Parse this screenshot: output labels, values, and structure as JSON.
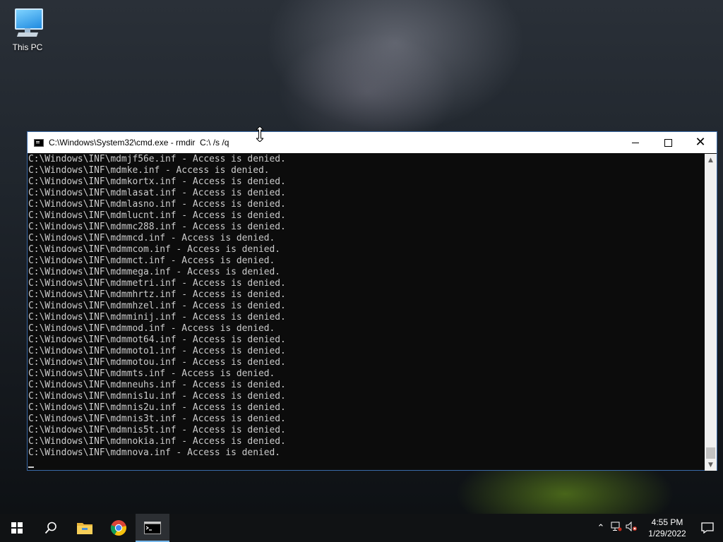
{
  "desktop": {
    "icons": [
      {
        "label": "This PC",
        "icon": "computer-icon"
      }
    ]
  },
  "cmd_window": {
    "title": "C:\\Windows\\System32\\cmd.exe - rmdir  C:\\ /s /q",
    "icon": "command-prompt-icon",
    "buttons": {
      "minimize": "minimize-icon",
      "maximize": "maximize-icon",
      "close": "close-icon"
    },
    "lines": [
      "C:\\Windows\\INF\\mdmjf56e.inf - Access is denied.",
      "C:\\Windows\\INF\\mdmke.inf - Access is denied.",
      "C:\\Windows\\INF\\mdmkortx.inf - Access is denied.",
      "C:\\Windows\\INF\\mdmlasat.inf - Access is denied.",
      "C:\\Windows\\INF\\mdmlasno.inf - Access is denied.",
      "C:\\Windows\\INF\\mdmlucnt.inf - Access is denied.",
      "C:\\Windows\\INF\\mdmmc288.inf - Access is denied.",
      "C:\\Windows\\INF\\mdmmcd.inf - Access is denied.",
      "C:\\Windows\\INF\\mdmmcom.inf - Access is denied.",
      "C:\\Windows\\INF\\mdmmct.inf - Access is denied.",
      "C:\\Windows\\INF\\mdmmega.inf - Access is denied.",
      "C:\\Windows\\INF\\mdmmetri.inf - Access is denied.",
      "C:\\Windows\\INF\\mdmmhrtz.inf - Access is denied.",
      "C:\\Windows\\INF\\mdmmhzel.inf - Access is denied.",
      "C:\\Windows\\INF\\mdmminij.inf - Access is denied.",
      "C:\\Windows\\INF\\mdmmod.inf - Access is denied.",
      "C:\\Windows\\INF\\mdmmot64.inf - Access is denied.",
      "C:\\Windows\\INF\\mdmmoto1.inf - Access is denied.",
      "C:\\Windows\\INF\\mdmmotou.inf - Access is denied.",
      "C:\\Windows\\INF\\mdmmts.inf - Access is denied.",
      "C:\\Windows\\INF\\mdmneuhs.inf - Access is denied.",
      "C:\\Windows\\INF\\mdmnis1u.inf - Access is denied.",
      "C:\\Windows\\INF\\mdmnis2u.inf - Access is denied.",
      "C:\\Windows\\INF\\mdmnis3t.inf - Access is denied.",
      "C:\\Windows\\INF\\mdmnis5t.inf - Access is denied.",
      "C:\\Windows\\INF\\mdmnokia.inf - Access is denied.",
      "C:\\Windows\\INF\\mdmnova.inf - Access is denied."
    ]
  },
  "taskbar": {
    "apps": [
      {
        "name": "start",
        "icon": "windows-logo-icon"
      },
      {
        "name": "search",
        "icon": "search-icon"
      },
      {
        "name": "file-explorer",
        "icon": "folder-icon"
      },
      {
        "name": "chrome",
        "icon": "chrome-icon"
      },
      {
        "name": "command-prompt",
        "icon": "command-prompt-icon",
        "active": true
      }
    ],
    "tray": {
      "icons": [
        "chevron-up-icon",
        "network-icon",
        "volume-muted-icon"
      ],
      "time": "4:55 PM",
      "date": "1/29/2022",
      "notification_icon": "notification-icon"
    }
  },
  "colors": {
    "console_bg": "#0c0c0c",
    "console_text": "#cccccc",
    "taskbar_bg": "#101214",
    "active_indicator": "#76b9ed"
  }
}
